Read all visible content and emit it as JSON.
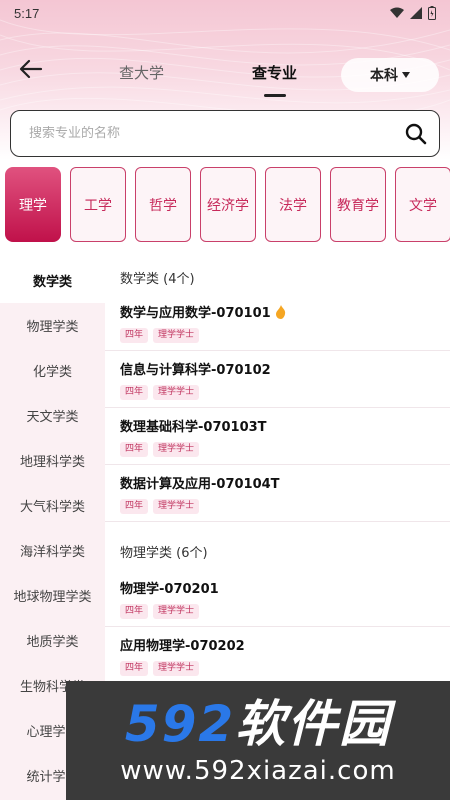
{
  "status": {
    "time": "5:17"
  },
  "header": {
    "tabs": [
      {
        "label": "查大学",
        "active": false
      },
      {
        "label": "查专业",
        "active": true
      }
    ],
    "level": "本科"
  },
  "search": {
    "placeholder": "搜索专业的名称"
  },
  "categories": [
    {
      "label": "理学",
      "active": true
    },
    {
      "label": "工学"
    },
    {
      "label": "哲学"
    },
    {
      "label": "经济学"
    },
    {
      "label": "法学"
    },
    {
      "label": "教育学"
    },
    {
      "label": "文学"
    }
  ],
  "sidebar": [
    {
      "label": "数学类",
      "active": true
    },
    {
      "label": "物理学类"
    },
    {
      "label": "化学类"
    },
    {
      "label": "天文学类"
    },
    {
      "label": "地理科学类"
    },
    {
      "label": "大气科学类"
    },
    {
      "label": "海洋科学类"
    },
    {
      "label": "地球物理学类"
    },
    {
      "label": "地质学类"
    },
    {
      "label": "生物科学类"
    },
    {
      "label": "心理学类"
    },
    {
      "label": "统计学类"
    }
  ],
  "groups": [
    {
      "title": "数学类 (4个)",
      "majors": [
        {
          "name": "数学与应用数学-070101",
          "hot": true,
          "tags": [
            "四年",
            "理学学士"
          ]
        },
        {
          "name": "信息与计算科学-070102",
          "tags": [
            "四年",
            "理学学士"
          ]
        },
        {
          "name": "数理基础科学-070103T",
          "tags": [
            "四年",
            "理学学士"
          ]
        },
        {
          "name": "数据计算及应用-070104T",
          "tags": [
            "四年",
            "理学学士"
          ]
        }
      ]
    },
    {
      "title": "物理学类 (6个)",
      "majors": [
        {
          "name": "物理学-070201",
          "tags": [
            "四年",
            "理学学士"
          ]
        },
        {
          "name": "应用物理学-070202",
          "tags": [
            "四年",
            "理学学士"
          ]
        }
      ]
    }
  ],
  "ad": {
    "logo_num": "592",
    "logo_text": "软件园",
    "url": "www.592xiazai.com"
  },
  "colors": {
    "accent": "#c72a5b",
    "active_gradient_top": "#e0527f",
    "active_gradient_bottom": "#c0114a"
  }
}
